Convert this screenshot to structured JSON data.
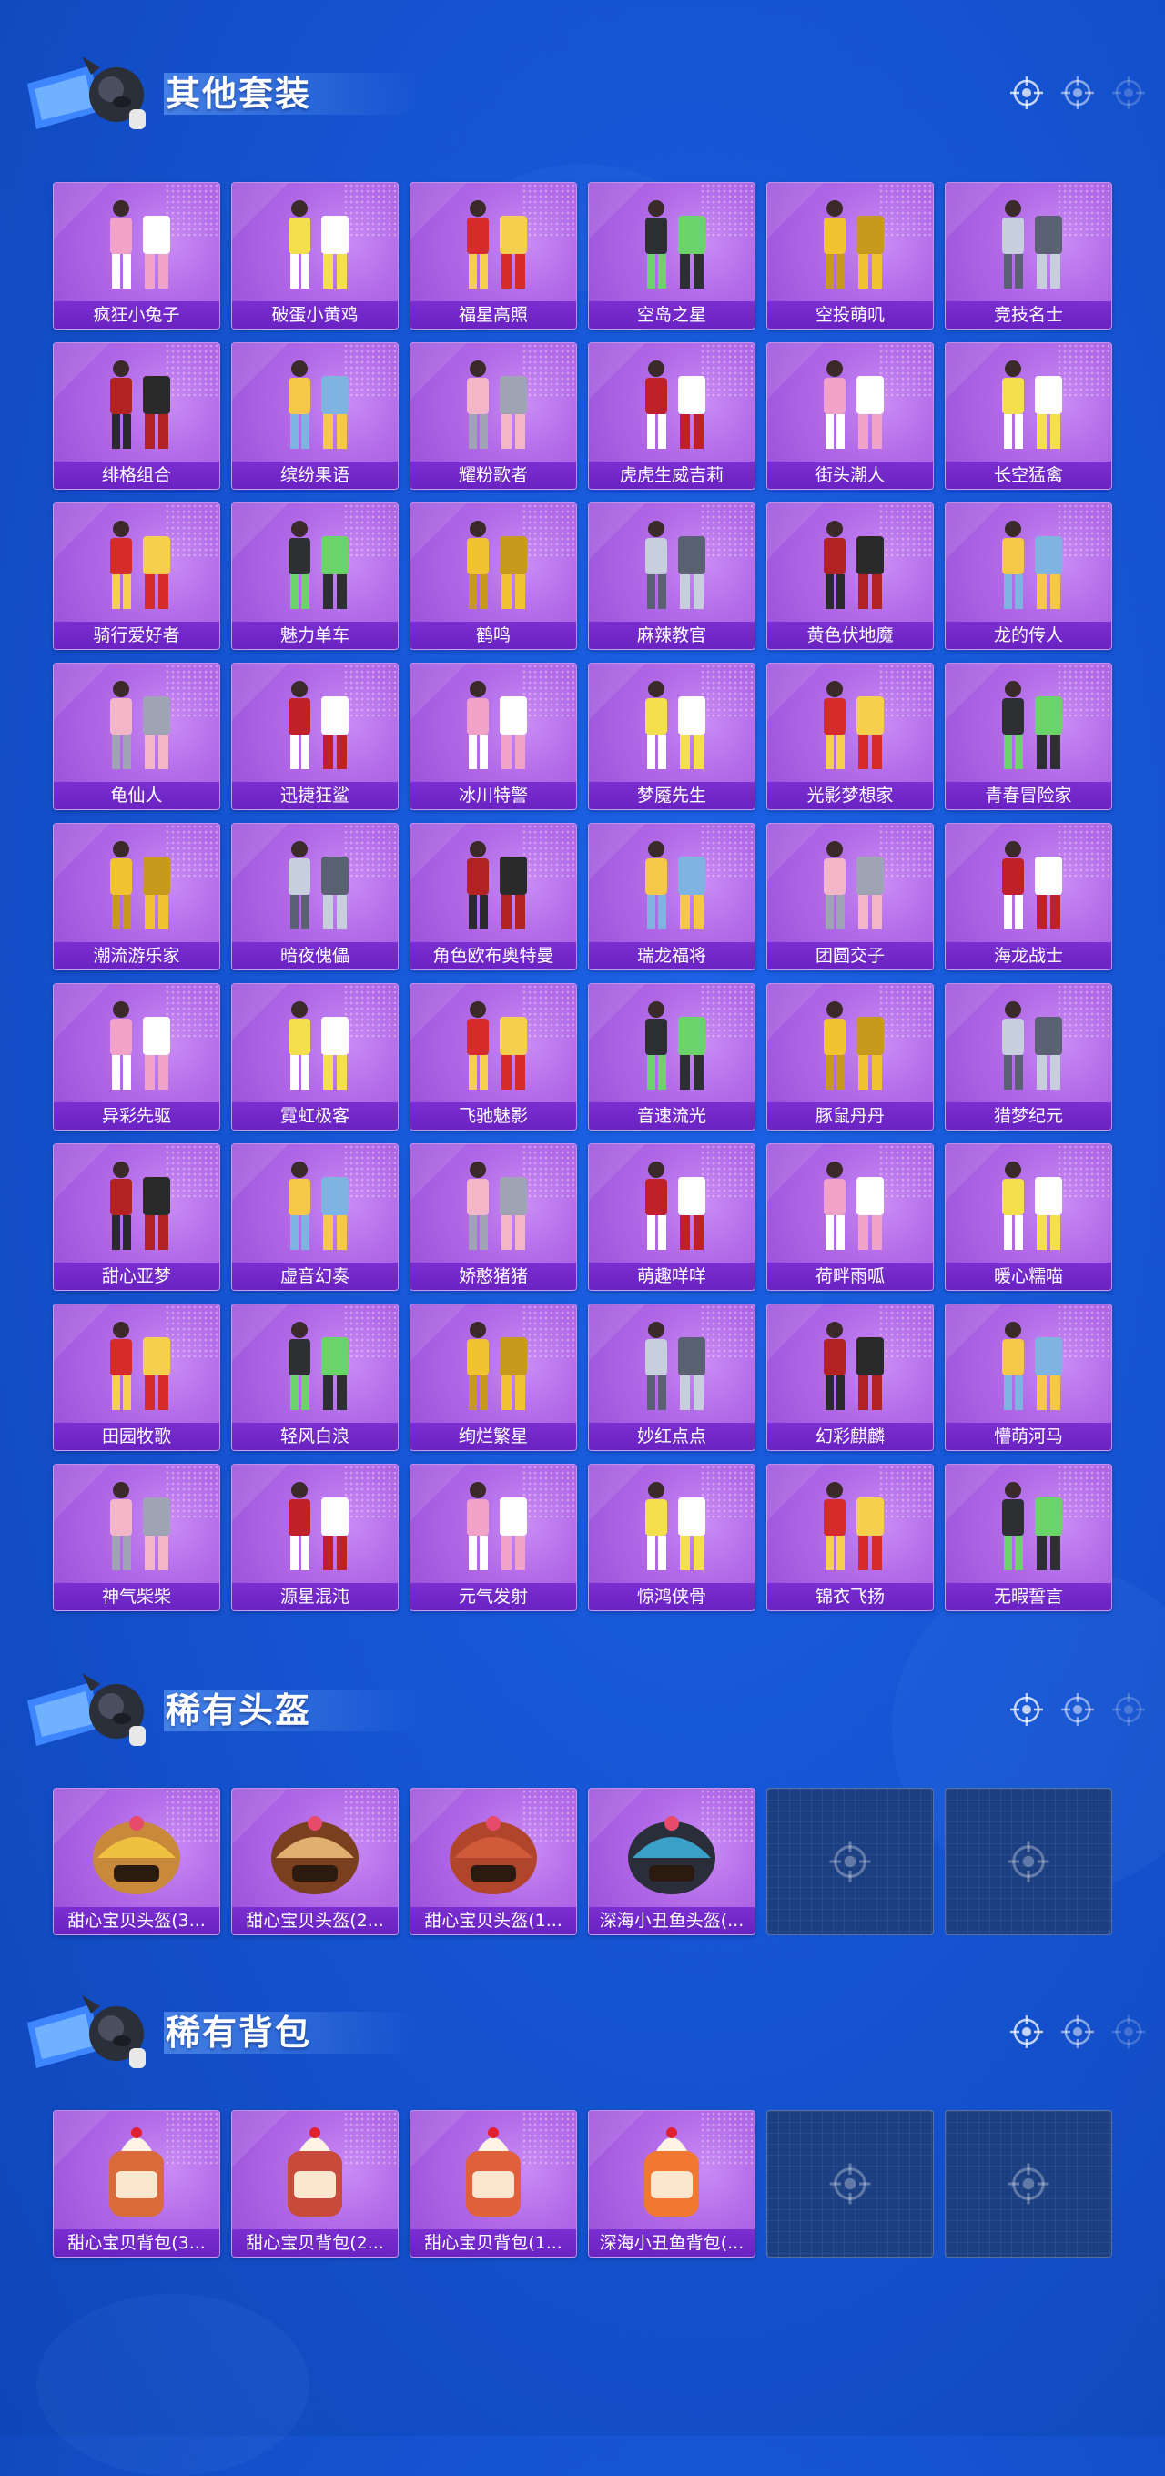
{
  "colors": {
    "background": "#1655d4",
    "card": "#b26ae8",
    "label_bar": "#7b2fd1",
    "empty_slot": "#1c3f82"
  },
  "sections": [
    {
      "title": "其他套装",
      "items": [
        "疯狂小兔子",
        "破蛋小黄鸡",
        "福星高照",
        "空岛之星",
        "空投萌叽",
        "竞技名士",
        "绯格组合",
        "缤纷果语",
        "耀粉歌者",
        "虎虎生威吉莉",
        "街头潮人",
        "长空猛禽",
        "骑行爱好者",
        "魅力单车",
        "鹤鸣",
        "麻辣教官",
        "黄色伏地魔",
        "龙的传人",
        "龟仙人",
        "迅捷狂鲨",
        "冰川特警",
        "梦魇先生",
        "光影梦想家",
        "青春冒险家",
        "潮流游乐家",
        "暗夜傀儡",
        "角色欧布奥特曼",
        "瑞龙福将",
        "团圆交子",
        "海龙战士",
        "异彩先驱",
        "霓虹极客",
        "飞驰魅影",
        "音速流光",
        "豚鼠丹丹",
        "猎梦纪元",
        "甜心亚梦",
        "虚音幻奏",
        "娇憨猪猪",
        "萌趣咩咩",
        "荷畔雨呱",
        "暖心糯喵",
        "田园牧歌",
        "轻风白浪",
        "绚烂繁星",
        "妙红点点",
        "幻彩麒麟",
        "懵萌河马",
        "神气柴柴",
        "源星混沌",
        "元气发射",
        "惊鸿侠骨",
        "锦衣飞扬",
        "无暇誓言"
      ]
    },
    {
      "title": "稀有头盔",
      "items": [
        "甜心宝贝头盔(3...",
        "甜心宝贝头盔(2...",
        "甜心宝贝头盔(1...",
        "深海小丑鱼头盔(..."
      ],
      "empty_slots": 2
    },
    {
      "title": "稀有背包",
      "items": [
        "甜心宝贝背包(3...",
        "甜心宝贝背包(2...",
        "甜心宝贝背包(1...",
        "深海小丑鱼背包(..."
      ],
      "empty_slots": 2
    }
  ],
  "icons": {
    "header_marker": "crosshair-icon",
    "empty_slot": "crosshair-icon",
    "mascot": "mascot-icon"
  }
}
